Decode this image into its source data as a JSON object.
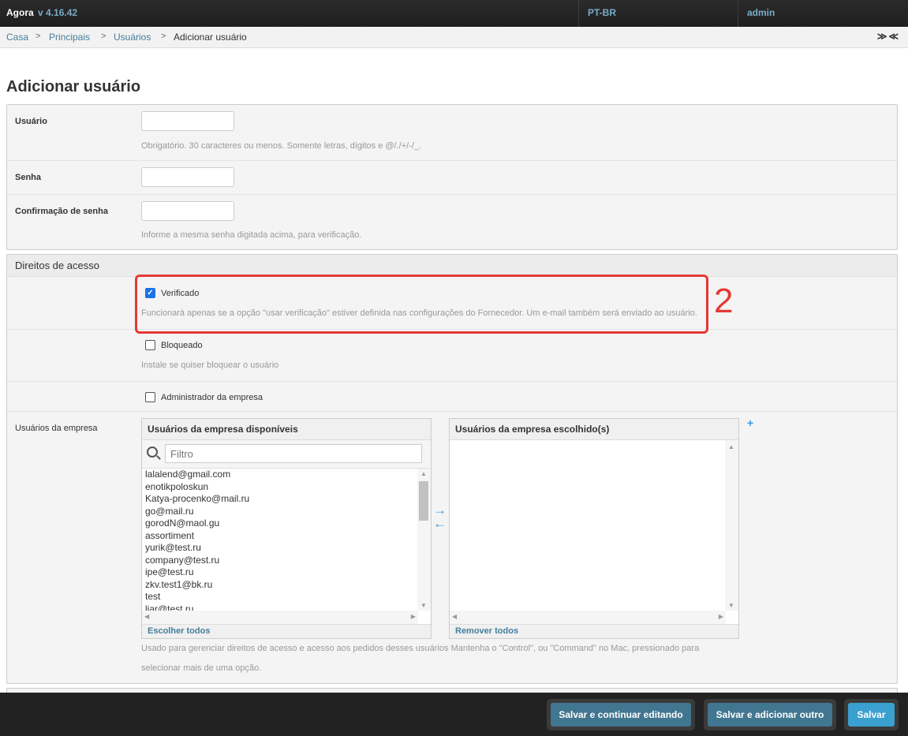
{
  "header": {
    "brand": "Agora",
    "version": "v 4.16.42",
    "language": "PT-BR",
    "user": "admin"
  },
  "breadcrumbs": {
    "home": "Casa",
    "principal": "Principais",
    "users": "Usuários",
    "current": "Adicionar usuário"
  },
  "collapse_controls": "≫≪",
  "page_title": "Adicionar usuário",
  "form": {
    "username_label": "Usuário",
    "username_value": "",
    "username_help": "Obrigatório. 30 caracteres ou menos. Somente letras, dígitos e @/./+/-/_.",
    "password_label": "Senha",
    "password_value": "",
    "password_confirm_label": "Confirmação de senha",
    "password_confirm_value": "",
    "password_confirm_help": "Informe a mesma senha digitada acima, para verificação."
  },
  "access": {
    "section_title": "Direitos de acesso",
    "verified_label": "Verificado",
    "verified_checked": true,
    "verified_help": "Funcionará apenas se a opção \"usar verificação\" estiver definida nas configurações do Fornecedor. Um e-mail também será enviado ao usuário.",
    "blocked_label": "Bloqueado",
    "blocked_checked": false,
    "blocked_help": "Instale se quiser bloquear o usuário",
    "company_admin_label": "Administrador da empresa",
    "company_admin_checked": false,
    "annotation": "2"
  },
  "company_users": {
    "label": "Usuários da empresa",
    "available_title": "Usuários da empresa disponíveis",
    "filter_placeholder": "Filtro",
    "available": [
      "lalalend@gmail.com",
      "enotikpoloskun",
      "Katya-procenko@mail.ru",
      "go@mail.ru",
      "gorodN@maol.gu",
      "assortiment",
      "yurik@test.ru",
      "company@test.ru",
      "ipe@test.ru",
      "zkv.test1@bk.ru",
      "test",
      "liar@test.ru"
    ],
    "chosen_title": "Usuários da empresa escolhido(s)",
    "chosen": [],
    "choose_all": "Escolher todos",
    "remove_all": "Remover todos",
    "add_icon": "+",
    "help_line1": "Usado para gerenciar direitos de acesso e acesso aos pedidos desses usuários Mantenha o \"Control\", ou \"Command\" no Mac, pressionado para",
    "help_line2": "selecionar mais de uma opção."
  },
  "actions": {
    "save_continue": "Salvar e continuar editando",
    "save_add_another": "Salvar e adicionar outro",
    "save": "Salvar"
  },
  "colors": {
    "accent": "#417690",
    "link": "#447e9b",
    "annotation": "#e53935",
    "header_bg": "#222222"
  }
}
